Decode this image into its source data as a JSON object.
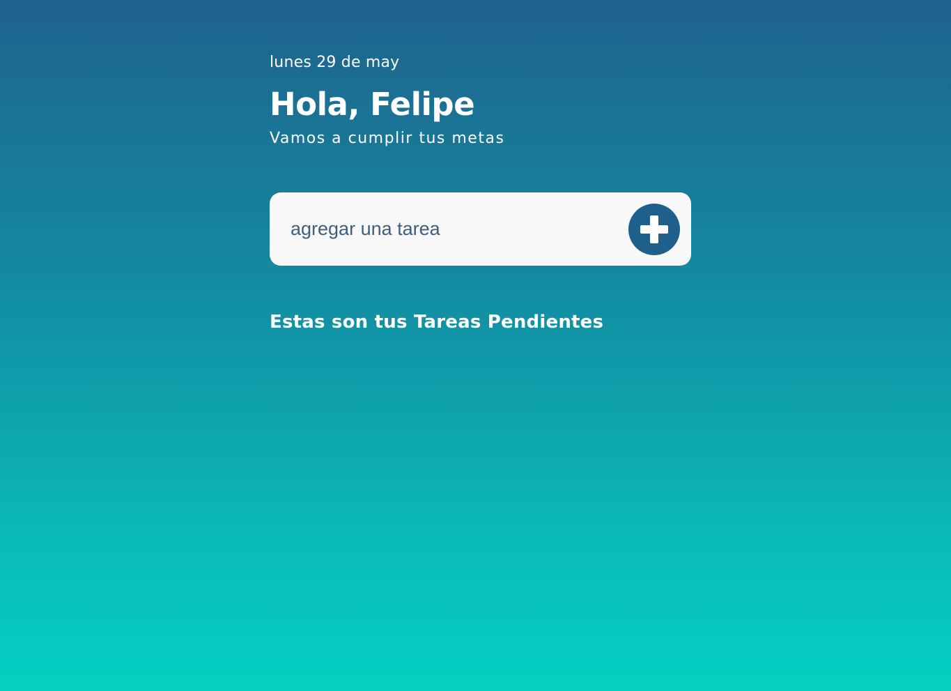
{
  "header": {
    "date": "lunes 29 de may",
    "greeting": "Hola, Felipe",
    "subtitle": "Vamos a cumplir tus metas"
  },
  "task_form": {
    "placeholder": "agregar una tarea",
    "add_icon": "plus-circle-icon"
  },
  "tasks": {
    "title": "Estas son tus Tareas Pendientes"
  },
  "colors": {
    "gradient_top": "#1f628d",
    "gradient_bottom": "#04d1c2",
    "button": "#1f5f8b",
    "card": "#f8f8f8"
  }
}
